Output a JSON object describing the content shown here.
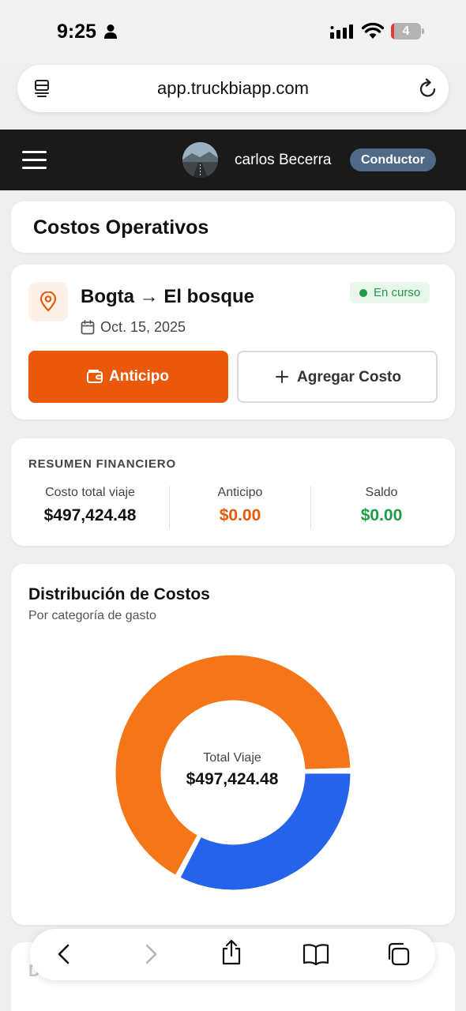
{
  "status_bar": {
    "time": "9:25",
    "battery": "4"
  },
  "browser": {
    "url": "app.truckbiapp.com"
  },
  "header": {
    "user_name": "carlos Becerra",
    "role": "Conductor"
  },
  "page": {
    "title": "Costos Operativos"
  },
  "trip": {
    "origin": "Bogta",
    "arrow": "→",
    "destination": "El bosque",
    "route": "Bogta → El bosque",
    "status": "En curso",
    "date": "Oct. 15, 2025",
    "anticipo_button": "Anticipo",
    "add_cost_button": "Agregar Costo"
  },
  "summary": {
    "title": "RESUMEN FINANCIERO",
    "total_label": "Costo total viaje",
    "total_value": "$497,424.48",
    "anticipo_label": "Anticipo",
    "anticipo_value": "$0.00",
    "saldo_label": "Saldo",
    "saldo_value": "$0.00"
  },
  "chart": {
    "title": "Distribución de Costos",
    "subtitle": "Por categoría de gasto",
    "center_label": "Total Viaje",
    "center_value": "$497,424.48"
  },
  "chart_data": {
    "type": "pie",
    "title": "Distribución de Costos",
    "subtitle": "Por categoría de gasto",
    "slices": [
      {
        "value": 67,
        "color": "#f47618"
      },
      {
        "value": 33,
        "color": "#2563eb"
      }
    ],
    "center_label": "Total Viaje",
    "center_value": "$497,424.48"
  },
  "peek": {
    "text": "D"
  },
  "colors": {
    "accent_orange": "#ea580c",
    "success_green": "#1e9b47",
    "header_bg": "#1a1a1a",
    "badge_bg": "#4f6a86"
  },
  "icons": [
    "person-icon",
    "signal-icon",
    "wifi-icon",
    "battery-icon",
    "tabs-icon",
    "reload-icon",
    "menu-icon",
    "location-pin-icon",
    "calendar-icon",
    "wallet-icon",
    "plus-icon",
    "back-icon",
    "forward-icon",
    "share-icon",
    "bookmarks-icon",
    "tabs-overview-icon"
  ]
}
